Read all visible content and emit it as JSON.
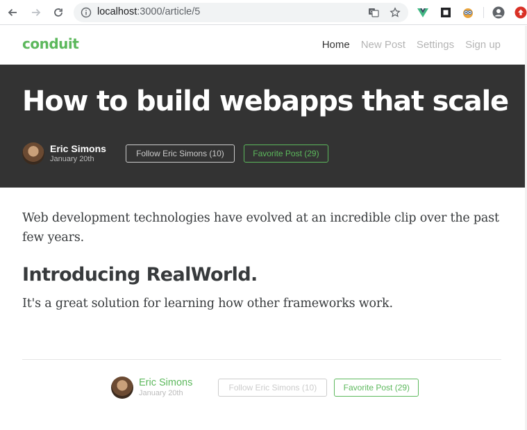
{
  "browser": {
    "url_host": "localhost",
    "url_rest": ":3000/article/5"
  },
  "navbar": {
    "brand": "conduit",
    "links": [
      {
        "label": "Home"
      },
      {
        "label": "New Post"
      },
      {
        "label": "Settings"
      },
      {
        "label": "Sign up"
      }
    ]
  },
  "article": {
    "title": "How to build webapps that scale",
    "author": "Eric Simons",
    "date": "January 20th",
    "follow_label": "Follow Eric Simons (10)",
    "favorite_label": "Favorite Post (29)",
    "paragraph1": "Web development technologies have evolved at an incredible clip over the past few years.",
    "heading": "Introducing RealWorld.",
    "paragraph2": "It's a great solution for learning how other frameworks work."
  },
  "colors": {
    "brand": "#5cb85c",
    "banner": "#333333"
  }
}
